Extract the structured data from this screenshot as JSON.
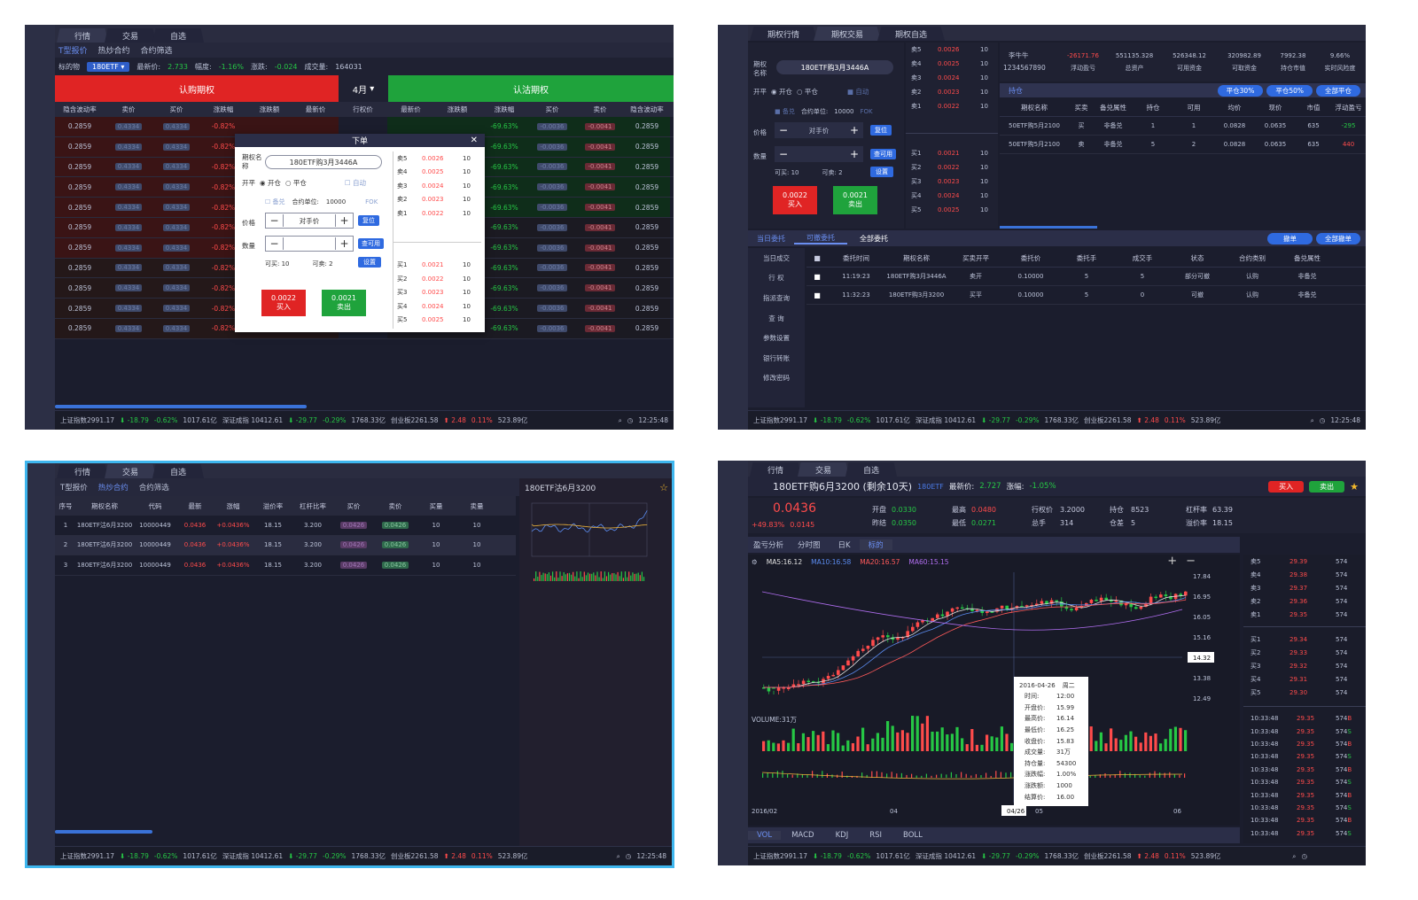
{
  "common": {
    "status_bar": {
      "sh_label": "上证指数2991.17",
      "sh_change": "-18.79",
      "sh_pct": "-0.62%",
      "sh_amount": "1017.61亿",
      "sz_label": "深证成指 10412.61",
      "sz_change": "-29.77",
      "sz_pct": "-0.29%",
      "sz_amount": "1768.33亿",
      "cy_label": "创业板2261.58",
      "cy_change": "2.48",
      "cy_pct": "0.11%",
      "cy_amount": "523.89亿",
      "time": "12:25:48"
    }
  },
  "panel1": {
    "tabs": [
      "行情",
      "交易",
      "自选"
    ],
    "subtabs": [
      "T型报价",
      "热炒合约",
      "合约筛选"
    ],
    "info": {
      "underlying_label": "标的物",
      "underlying_value": "180ETF",
      "last_label": "最新价:",
      "last_value": "2.733",
      "range_label": "幅度:",
      "range_value": "-1.16%",
      "change_label": "涨跌:",
      "change_value": "-0.024",
      "volume_label": "成交量:",
      "volume_value": "164031"
    },
    "call_label": "认购期权",
    "put_label": "认沽期权",
    "month": "4月",
    "columns": [
      "隐含波动率",
      "卖价",
      "买价",
      "涨跌幅",
      "涨跌额",
      "最新价",
      "行权价",
      "最新价",
      "涨跌额",
      "涨跌幅",
      "买价",
      "卖价",
      "隐含波动率"
    ],
    "row_values": {
      "iv": "0.2859",
      "ask": "0.4334",
      "bid": "0.4334",
      "pct": "-0.82%",
      "amt": "-0.0036",
      "last": "0.4334",
      "strike": "2.3500",
      "p_pct": "-69.63%",
      "p_chg": "-0.0036",
      "p_bid": "-0.0041"
    },
    "order_dialog": {
      "title": "下单",
      "name_label": "期权名称",
      "name_value": "180ETF购3月3446A",
      "open_close_label": "开平",
      "open": "开仓",
      "close": "平仓",
      "auto": "自动",
      "covered": "备兑",
      "unit_label": "合约单位:",
      "unit_value": "10000",
      "fok": "FOK",
      "price_label": "价格",
      "price_value": "对手价",
      "reset": "复位",
      "qty_label": "数量",
      "max": "查可用",
      "avail_buy": "可买: 10",
      "avail_sell": "可卖: 2",
      "settings": "设置",
      "buy_price": "0.0022",
      "buy_label": "买入",
      "sell_price": "0.0021",
      "sell_label": "卖出"
    },
    "book": {
      "asks": [
        [
          "卖5",
          "0.0026",
          "10"
        ],
        [
          "卖4",
          "0.0025",
          "10"
        ],
        [
          "卖3",
          "0.0024",
          "10"
        ],
        [
          "卖2",
          "0.0023",
          "10"
        ],
        [
          "卖1",
          "0.0022",
          "10"
        ]
      ],
      "bids": [
        [
          "买1",
          "0.0021",
          "10"
        ],
        [
          "买2",
          "0.0022",
          "10"
        ],
        [
          "买3",
          "0.0023",
          "10"
        ],
        [
          "买4",
          "0.0024",
          "10"
        ],
        [
          "买5",
          "0.0025",
          "10"
        ]
      ]
    }
  },
  "panel2": {
    "tabs": [
      "期权行情",
      "期权交易",
      "期权自选"
    ],
    "account": {
      "name": "李牛牛",
      "id": "1234567890",
      "pnl": "-26171.76",
      "pnl_label": "浮动盈亏",
      "total": "551135.328",
      "total_label": "总资产",
      "available": "526348.12",
      "available_label": "可用资金",
      "withdraw": "320982.89",
      "withdraw_label": "可取资金",
      "market": "7992.38",
      "market_label": "持仓市值",
      "risk": "9.66%",
      "risk_label": "实时风险度"
    },
    "position_tab": "持仓",
    "position_buttons": [
      "平仓30%",
      "平仓50%",
      "全部平仓"
    ],
    "position_columns": [
      "期权名称",
      "买卖",
      "备兑属性",
      "持仓",
      "可用",
      "均价",
      "现价",
      "市值",
      "浮动盈亏"
    ],
    "positions": [
      [
        "50ETF购5月2100",
        "买",
        "非备兑",
        "1",
        "1",
        "0.0828",
        "0.0635",
        "635",
        "-295"
      ],
      [
        "50ETF购5月2100",
        "卖",
        "非备兑",
        "5",
        "2",
        "0.0828",
        "0.0635",
        "635",
        "440"
      ]
    ],
    "order_tabs": [
      "当日委托",
      "可撤委托",
      "全部委托"
    ],
    "order_buttons": [
      "撤单",
      "全部撤单"
    ],
    "sidebar": [
      "当日成交",
      "行 权",
      "指派查询",
      "查 询",
      "参数设置",
      "银行转账",
      "修改密码"
    ],
    "order_columns": [
      "委托时间",
      "期权名称",
      "买卖开平",
      "委托价",
      "委托手",
      "成交手",
      "状态",
      "合约类别",
      "备兑属性"
    ],
    "orders": [
      [
        "11:19:23",
        "180ETF购3月3446A",
        "卖开",
        "0.10000",
        "5",
        "5",
        "部分可撤",
        "认购",
        "非备兑"
      ],
      [
        "11:32:23",
        "180ETF购3月3200",
        "买平",
        "0.10000",
        "5",
        "0",
        "可撤",
        "认购",
        "非备兑"
      ]
    ]
  },
  "panel3": {
    "tabs": [
      "行情",
      "交易",
      "自选"
    ],
    "subtabs": [
      "T型报价",
      "热炒合约",
      "合约筛选"
    ],
    "columns": [
      "序号",
      "期权名称",
      "代码",
      "最新",
      "涨幅",
      "溢价率",
      "杠杆比率",
      "买价",
      "卖价",
      "买量",
      "卖量"
    ],
    "rows": [
      [
        "1",
        "180ETF沽6月3200",
        "10000449",
        "0.0436",
        "+0.0436%",
        "18.15",
        "3.200",
        "0.0426",
        "0.0426",
        "10",
        "10"
      ],
      [
        "2",
        "180ETF沽6月3200",
        "10000449",
        "0.0436",
        "+0.0436%",
        "18.15",
        "3.200",
        "0.0426",
        "0.0426",
        "10",
        "10"
      ],
      [
        "3",
        "180ETF沽6月3200",
        "10000449",
        "0.0436",
        "+0.0436%",
        "18.15",
        "3.200",
        "0.0426",
        "0.0426",
        "10",
        "10"
      ]
    ],
    "side_title": "180ETF沽6月3200"
  },
  "panel4": {
    "tabs": [
      "行情",
      "交易",
      "自选"
    ],
    "title": "180ETF购6月3200 (剩余10天)",
    "underlying": "180ETF",
    "last_label": "最新价:",
    "last_value": "2.727",
    "chg_label": "涨幅:",
    "chg_value": "-1.05%",
    "buy": "买入",
    "sell": "卖出",
    "price": "0.0436",
    "price_chg": "+49.83%",
    "price_amt": "0.0145",
    "stats": [
      [
        "开盘",
        "0.0330",
        "最高",
        "0.0480",
        "行权价",
        "3.2000",
        "持仓",
        "8523",
        "杠杆率",
        "63.39"
      ],
      [
        "昨结",
        "0.0350",
        "最低",
        "0.0271",
        "总手",
        "314",
        "仓差",
        "5",
        "溢价率",
        "18.15"
      ]
    ],
    "chart_tabs": [
      "盈亏分析",
      "分时图",
      "日K",
      "标的"
    ],
    "ma_labels": [
      "MA5:16.12",
      "MA10:16.58",
      "MA20:16.57",
      "MA60:15.15"
    ],
    "y_ticks": [
      "17.84",
      "16.95",
      "16.05",
      "15.16",
      "14.32",
      "13.38",
      "12.49"
    ],
    "volume_label": "VOLUME:31万",
    "x_ticks": [
      "2016/02",
      "04",
      "04/26",
      "05",
      "06"
    ],
    "tooltip": {
      "date": "2016-04-26",
      "weekday": "周二",
      "rows": [
        [
          "时间:",
          "12:00"
        ],
        [
          "开盘价:",
          "15.99"
        ],
        [
          "最高价:",
          "16.14"
        ],
        [
          "最低价:",
          "16.25"
        ],
        [
          "收盘价:",
          "15.83"
        ],
        [
          "成交量:",
          "31万"
        ],
        [
          "持仓量:",
          "54300"
        ],
        [
          "涨跌幅:",
          "1.00%"
        ],
        [
          "涨跌额:",
          "1000"
        ],
        [
          "结算价:",
          "16.00"
        ]
      ]
    },
    "indicator_tabs": [
      "VOL",
      "MACD",
      "KDJ",
      "RSI",
      "BOLL"
    ],
    "book": {
      "asks": [
        [
          "卖5",
          "29.39",
          "574"
        ],
        [
          "卖4",
          "29.38",
          "574"
        ],
        [
          "卖3",
          "29.37",
          "574"
        ],
        [
          "卖2",
          "29.36",
          "574"
        ],
        [
          "卖1",
          "29.35",
          "574"
        ]
      ],
      "bids": [
        [
          "买1",
          "29.34",
          "574"
        ],
        [
          "买2",
          "29.33",
          "574"
        ],
        [
          "买3",
          "29.32",
          "574"
        ],
        [
          "买4",
          "29.31",
          "574"
        ],
        [
          "买5",
          "29.30",
          "574"
        ]
      ]
    },
    "ticks": [
      "10:33:48",
      "29.35",
      "574"
    ]
  },
  "colors": {
    "up": "#ff4b4b",
    "down": "#26c745",
    "accent": "#2f6ae0",
    "highlight_border": "#3eb6ee"
  }
}
